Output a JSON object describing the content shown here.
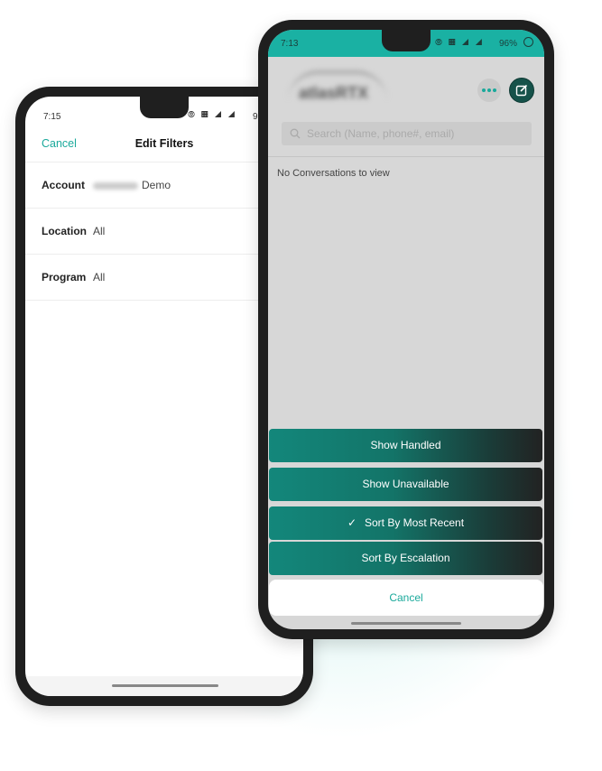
{
  "left_phone": {
    "status_time": "7:15",
    "status_icons": [
      "hotspot-icon",
      "volte-icon",
      "signal-icon",
      "4g-signal-icon"
    ],
    "battery_partial": "9",
    "nav": {
      "cancel_label": "Cancel",
      "title": "Edit Filters"
    },
    "filters": [
      {
        "label": "Account",
        "value": "Demo",
        "value_redacted_prefix": true
      },
      {
        "label": "Location",
        "value": "All"
      },
      {
        "label": "Program",
        "value": "All"
      }
    ]
  },
  "right_phone": {
    "status_time": "7:13",
    "battery_percent": "96%",
    "logo_text": "atlasRTX",
    "more_icon": "more-horizontal-icon",
    "compose_icon": "compose-icon",
    "search": {
      "placeholder": "Search (Name, phone#, email)",
      "value": ""
    },
    "empty_message": "No Conversations to view",
    "action_sheet": {
      "options": [
        {
          "label": "Show Handled",
          "checked": false
        },
        {
          "label": "Show Unavailable",
          "checked": false
        },
        {
          "label": "Sort By Most Recent",
          "checked": true
        },
        {
          "label": "Sort By Escalation",
          "checked": false
        }
      ],
      "cancel_label": "Cancel",
      "check_glyph": "✓"
    }
  },
  "colors": {
    "accent": "#1aa99b",
    "statusbar": "#1ab1a3",
    "sheet_dark": "#222222",
    "sheet_teal": "#13877b"
  }
}
